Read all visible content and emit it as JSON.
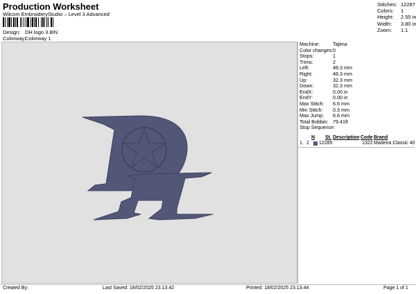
{
  "header": {
    "title": "Production Worksheet",
    "subtitle": "Wilcom EmbroideryStudio – Level 3 Advanced"
  },
  "design": {
    "design_label": "Design:",
    "design_value": "DH logo 3.8IN",
    "colorway_label": "Colorway:",
    "colorway_value": "Colorway 1"
  },
  "stats": [
    {
      "label": "Stitches:",
      "value": "12287"
    },
    {
      "label": "Colors:",
      "value": "1"
    },
    {
      "label": "Height:",
      "value": "2.55 in"
    },
    {
      "label": "Width:",
      "value": "3.80 in"
    },
    {
      "label": "Zoom:",
      "value": "1:1"
    }
  ],
  "machine_info": [
    {
      "label": "Machine:",
      "value": "Tajima"
    },
    {
      "label": "Color changes:",
      "value": "0"
    },
    {
      "label": "Stops:",
      "value": "1"
    },
    {
      "label": "Trims:",
      "value": "2"
    },
    {
      "label": "Left:",
      "value": "48.3 mm"
    },
    {
      "label": "Right:",
      "value": "48.3 mm"
    },
    {
      "label": "Up:",
      "value": "32.3 mm"
    },
    {
      "label": "Down:",
      "value": "32.3 mm"
    },
    {
      "label": "EndX:",
      "value": "0.00 in"
    },
    {
      "label": "EndY:",
      "value": "0.00 in"
    },
    {
      "label": "Max Stitch:",
      "value": "6.6 mm"
    },
    {
      "label": "Min Stitch:",
      "value": "0.3 mm"
    },
    {
      "label": "Max Jump:",
      "value": "6.6 mm"
    },
    {
      "label": "Total Bobbin:",
      "value": "79.41ft"
    }
  ],
  "stop_sequence": {
    "title": "Stop Sequence:",
    "columns": [
      "N",
      "St.",
      "Description",
      "Code",
      "Brand"
    ],
    "rows": [
      {
        "index": "1.",
        "n": "2",
        "st": "12285",
        "description": "",
        "code": "1322",
        "brand": "Madeira Classic 40",
        "color": "#55597a"
      }
    ]
  },
  "design_color": "#55597a",
  "canvas_color": "#e1e1e1",
  "footer": {
    "created_by": "Created By:",
    "last_saved": "Last Saved: 18/02/2025 23.13.42",
    "printed": "Printed: 18/02/2025 23.13.44",
    "page": "Page 1 of 1"
  }
}
